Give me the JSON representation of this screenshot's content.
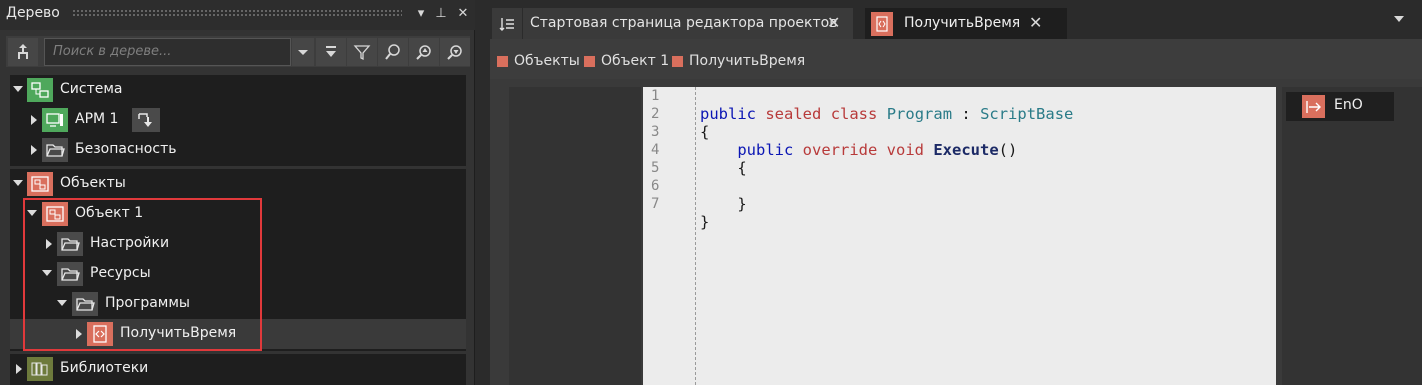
{
  "tree_panel": {
    "title": "Дерево",
    "search_placeholder": "Поиск в дереве...",
    "sections": {
      "system": {
        "label": "Система",
        "items": [
          {
            "label": "АРМ 1"
          },
          {
            "label": "Безопасность"
          }
        ]
      },
      "objects": {
        "label": "Объекты",
        "object1": {
          "label": "Объект 1",
          "settings": "Настройки",
          "resources": "Ресурсы",
          "programs": "Программы",
          "get_time": "ПолучитьВремя"
        }
      },
      "libraries": {
        "label": "Библиотеки"
      }
    }
  },
  "editor": {
    "tabs": [
      {
        "label": "Стартовая страница редактора проектов"
      },
      {
        "label": "ПолучитьВремя",
        "active": true
      }
    ],
    "breadcrumbs": [
      "Объекты",
      "Объект 1",
      "ПолучитьВремя"
    ],
    "line_numbers": [
      "1",
      "2",
      "3",
      "4",
      "5",
      "6",
      "7"
    ],
    "code": {
      "line1": {
        "kw": "public",
        "mod1": "sealed",
        "mod2": "class",
        "type": "Program",
        "colon": ":",
        "base": "ScriptBase"
      },
      "line2": "{",
      "line3": {
        "kw": "public",
        "mod1": "override",
        "mod2": "void",
        "fn": "Execute",
        "paren": "()"
      },
      "line4": "{",
      "line6": "}",
      "line7": "}"
    },
    "output_pin": "EnO"
  },
  "colors": {
    "panel_bg": "#333333",
    "tree_bg": "#1e1e1e",
    "accent_red": "#d96f5d",
    "accent_green": "#4fa85c",
    "highlight_box": "#e0393b",
    "code_bg": "#ececec"
  }
}
